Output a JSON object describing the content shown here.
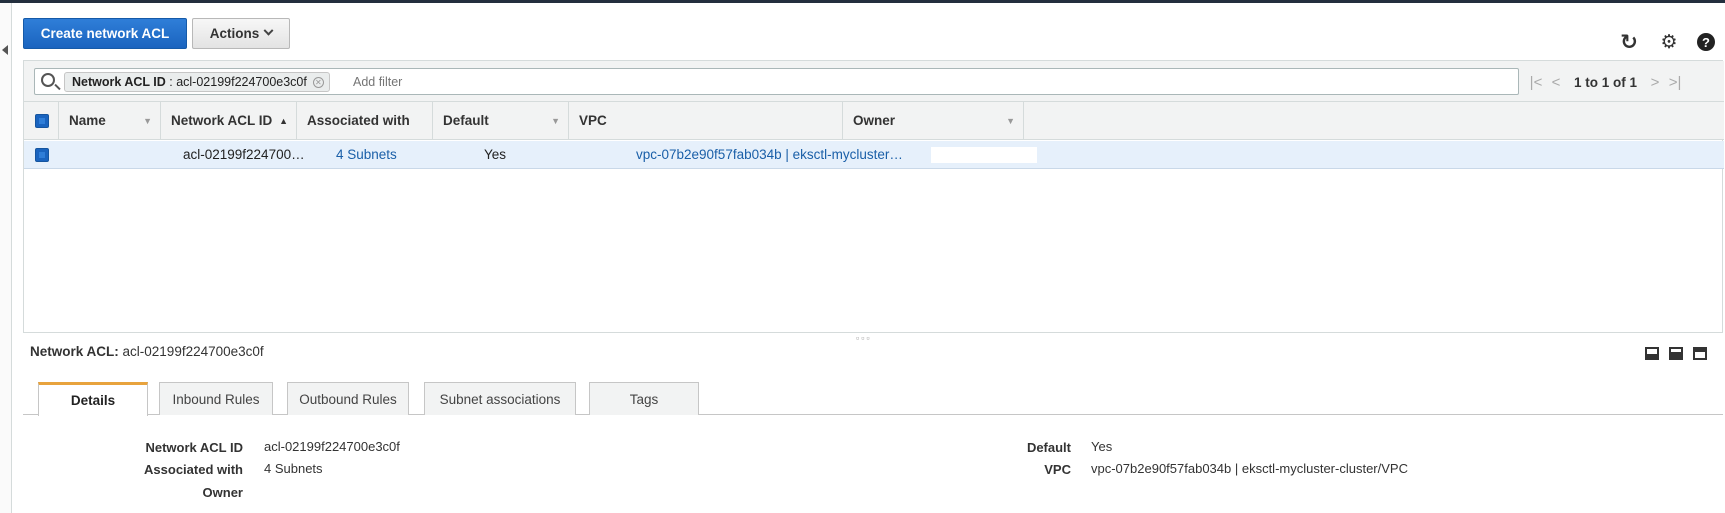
{
  "toolbar": {
    "create_label": "Create network ACL",
    "actions_label": "Actions"
  },
  "top_icons": {
    "refresh": "↻",
    "settings": "⚙",
    "help": "?"
  },
  "filter": {
    "token_key": "Network ACL ID",
    "token_value": ": acl-02199f224700e3c0f",
    "placeholder": "Add filter"
  },
  "pager": {
    "first": "|<",
    "prev": "<",
    "text": "1 to 1 of 1",
    "next": ">",
    "last": ">|"
  },
  "table": {
    "columns": [
      "Name",
      "Network ACL ID",
      "Associated with",
      "Default",
      "VPC",
      "Owner"
    ],
    "rows": [
      {
        "name": "",
        "acl_id": "acl-02199f224700…",
        "associated": "4 Subnets",
        "default": "Yes",
        "vpc": "vpc-07b2e90f57fab034b | eksctl-mycluster…",
        "owner": ""
      }
    ]
  },
  "detail": {
    "title_label": "Network ACL:",
    "title_value": "acl-02199f224700e3c0f",
    "tabs": [
      "Details",
      "Inbound Rules",
      "Outbound Rules",
      "Subnet associations",
      "Tags"
    ],
    "fields": {
      "acl_id_label": "Network ACL ID",
      "acl_id_value": "acl-02199f224700e3c0f",
      "associated_label": "Associated with",
      "associated_value": "4 Subnets",
      "owner_label": "Owner",
      "owner_value": "",
      "default_label": "Default",
      "default_value": "Yes",
      "vpc_label": "VPC",
      "vpc_value": "vpc-07b2e90f57fab034b | eksctl-mycluster-cluster/VPC"
    }
  }
}
